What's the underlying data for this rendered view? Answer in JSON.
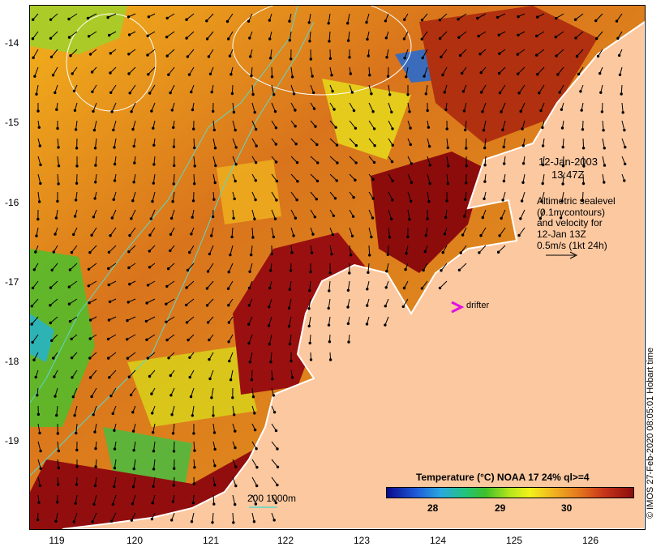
{
  "date": "12-Jan-2003",
  "time": "13:47Z",
  "altimetry_note": [
    "Altimetric sealevel",
    "(0.1m contours)",
    "and velocity for",
    "12-Jan 13Z",
    "0.5m/s (1kt 24h)"
  ],
  "drifter_label": "drifter",
  "depth_legend": "200  1000m",
  "legend_title": "Temperature (°C) NOAA 17 24% ql>=4",
  "colorbar_ticks": [
    "28",
    "29",
    "30"
  ],
  "credit": "© IMOS 27-Feb-2020 08:05:01 Hobart time",
  "lat_ticks": [
    "-14",
    "-15",
    "-16",
    "-17",
    "-18",
    "-19"
  ],
  "lon_ticks": [
    "119",
    "120",
    "121",
    "122",
    "123",
    "124",
    "125",
    "126"
  ],
  "colors": {
    "land": "#fcc8a0",
    "warm": "#8c0c0c",
    "mid": "#d86818",
    "cool": "#f0a818",
    "contour": "#5cd8c8",
    "drifter": "#e010e0"
  }
}
